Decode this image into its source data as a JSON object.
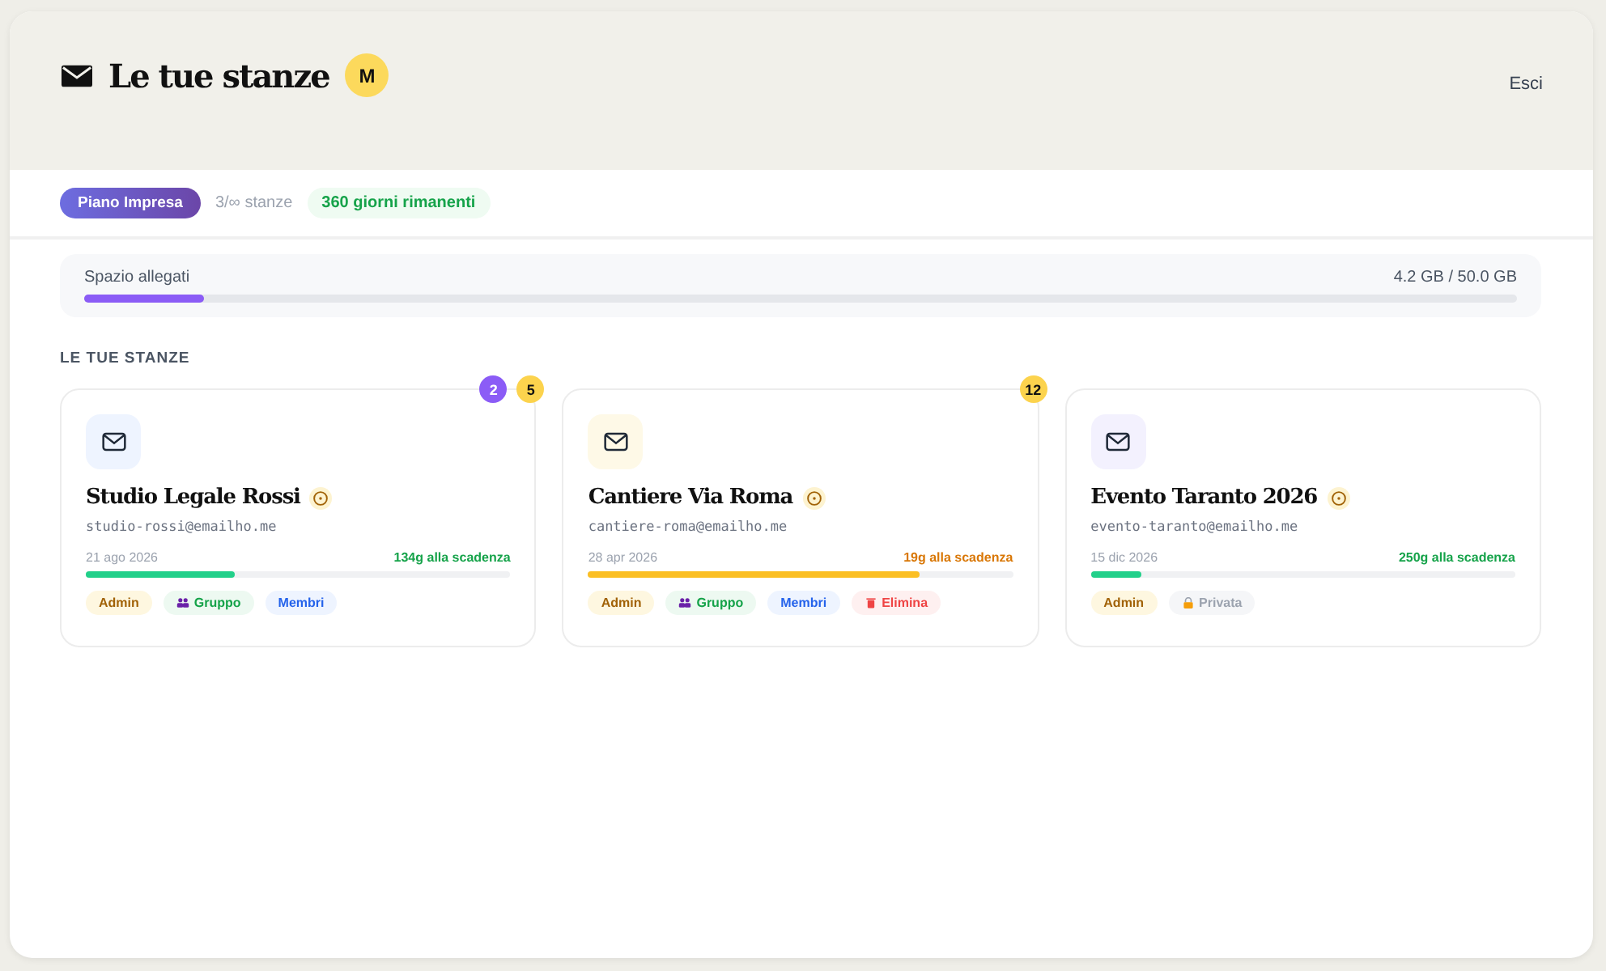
{
  "header": {
    "title": "Le tue stanze",
    "avatar": "M",
    "logout": "Esci"
  },
  "plan": {
    "name": "Piano Impresa",
    "rooms": "3/∞ stanze",
    "remaining": "360 giorni rimanenti"
  },
  "storage": {
    "label": "Spazio allegati",
    "reading": "4.2 GB / 50.0 GB",
    "level": 0.084
  },
  "section_title": "LE TUE STANZE",
  "rooms": [
    {
      "name": "Studio Legale Rossi",
      "email": "studio-rossi@emailho.me",
      "date": "21 ago 2026",
      "remaining": "134g alla scadenza",
      "warning": false,
      "level": 0.35,
      "color": "#eef4ff",
      "badges": [
        {
          "text": "2",
          "color": "#8b5cf6"
        },
        {
          "text": "5",
          "color": "#fcd34d"
        }
      ],
      "tags": [
        {
          "kind": "admin",
          "label": "Admin"
        },
        {
          "kind": "group",
          "label": "Gruppo"
        },
        {
          "kind": "members",
          "label": "Membri"
        }
      ]
    },
    {
      "name": "Cantiere Via Roma",
      "email": "cantiere-roma@emailho.me",
      "date": "28 apr 2026",
      "remaining": "19g alla scadenza",
      "warning": true,
      "level": 0.78,
      "color": "#fef9e7",
      "badges": [
        {
          "text": "12",
          "color": "#fcd34d"
        }
      ],
      "tags": [
        {
          "kind": "admin",
          "label": "Admin"
        },
        {
          "kind": "group",
          "label": "Gruppo"
        },
        {
          "kind": "members",
          "label": "Membri"
        },
        {
          "kind": "delete",
          "label": "Elimina"
        }
      ]
    },
    {
      "name": "Evento Taranto 2026",
      "email": "evento-taranto@emailho.me",
      "date": "15 dic 2026",
      "remaining": "250g alla scadenza",
      "warning": false,
      "level": 0.12,
      "color": "#f3f1fe",
      "tags": [
        {
          "kind": "admin",
          "label": "Admin"
        },
        {
          "kind": "private",
          "label": "Privata"
        }
      ]
    }
  ]
}
